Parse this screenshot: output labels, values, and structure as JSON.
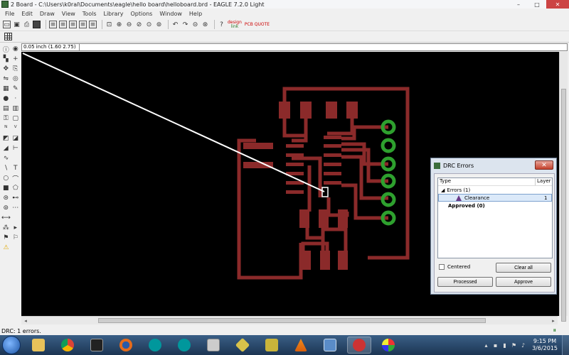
{
  "window": {
    "title": "2 Board - C:\\Users\\k0ral\\Documents\\eagle\\hello board\\helloboard.brd - EAGLE 7.2.0 Light",
    "controls": {
      "minimize": "–",
      "maximize": "□",
      "close": "✕"
    }
  },
  "menu": {
    "items": [
      "File",
      "Edit",
      "Draw",
      "View",
      "Tools",
      "Library",
      "Options",
      "Window",
      "Help"
    ]
  },
  "toolbar": {
    "logo_line1": "design",
    "logo_line2": "link",
    "pcb_quote_label": "PCB QUOTE"
  },
  "coords": {
    "readout": "0.05 inch (1.60 2.75)",
    "command_value": ""
  },
  "status": {
    "text": "DRC: 1 errors."
  },
  "clock": {
    "time": "9:15 PM",
    "date": "3/6/2015"
  },
  "drc": {
    "title": "DRC Errors",
    "close_label": "✕",
    "col_type": "Type",
    "col_layer": "Layer",
    "errors_group": "Errors (1)",
    "error_name": "Clearance",
    "error_layer": "1",
    "approved_group": "Approved (0)",
    "centered_label": "Centered",
    "clear_all_label": "Clear all",
    "processed_label": "Processed",
    "approve_label": "Approve"
  },
  "colors": {
    "trace": "#8b2a2a",
    "pad_via": "#2ea02e",
    "canvas_bg": "#000000",
    "selection": "#ffffff"
  }
}
